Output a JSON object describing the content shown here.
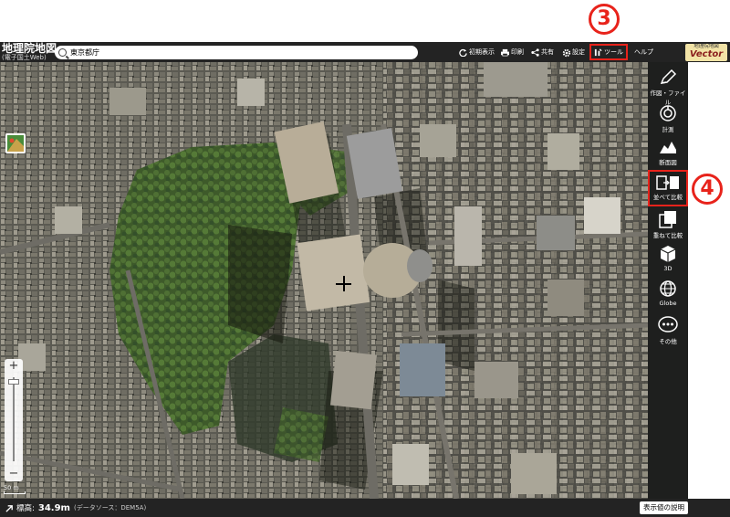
{
  "header": {
    "app_title": "地理院地図",
    "app_subtitle": "(電子国土Web)",
    "search_value": "東京都庁",
    "buttons": {
      "initial_view": "初期表示",
      "print": "印刷",
      "share": "共有",
      "settings": "設定",
      "tools": "ツール",
      "help": "ヘルプ"
    },
    "vector_logo_top": "地理院地図",
    "vector_logo_main": "Vector"
  },
  "annotations": {
    "step3": "3",
    "step4": "4"
  },
  "toolbar": {
    "items": [
      {
        "label": "作図・ファイル",
        "icon": "pencil-icon"
      },
      {
        "label": "計測",
        "icon": "measure-icon"
      },
      {
        "label": "断面図",
        "icon": "profile-icon"
      },
      {
        "label": "並べて比較",
        "icon": "side-by-side-icon"
      },
      {
        "label": "重ねて比較",
        "icon": "overlay-compare-icon"
      },
      {
        "label": "3D",
        "icon": "cube-icon"
      },
      {
        "label": "Globe",
        "icon": "globe-icon"
      },
      {
        "label": "その他",
        "icon": "more-icon"
      }
    ]
  },
  "map": {
    "scale_label": "50 m",
    "zoom_in": "+",
    "zoom_out": "−"
  },
  "footer": {
    "elevation_label": "標高:",
    "elevation_value": "34.9m",
    "data_source": "(データソース：DEM5A)",
    "legend_button": "表示値の説明"
  },
  "colors": {
    "annotation_red": "#e8231b",
    "header_bg": "#232323",
    "toolbar_bg": "#1e1f1e",
    "park_green": "#3f5a2b"
  }
}
